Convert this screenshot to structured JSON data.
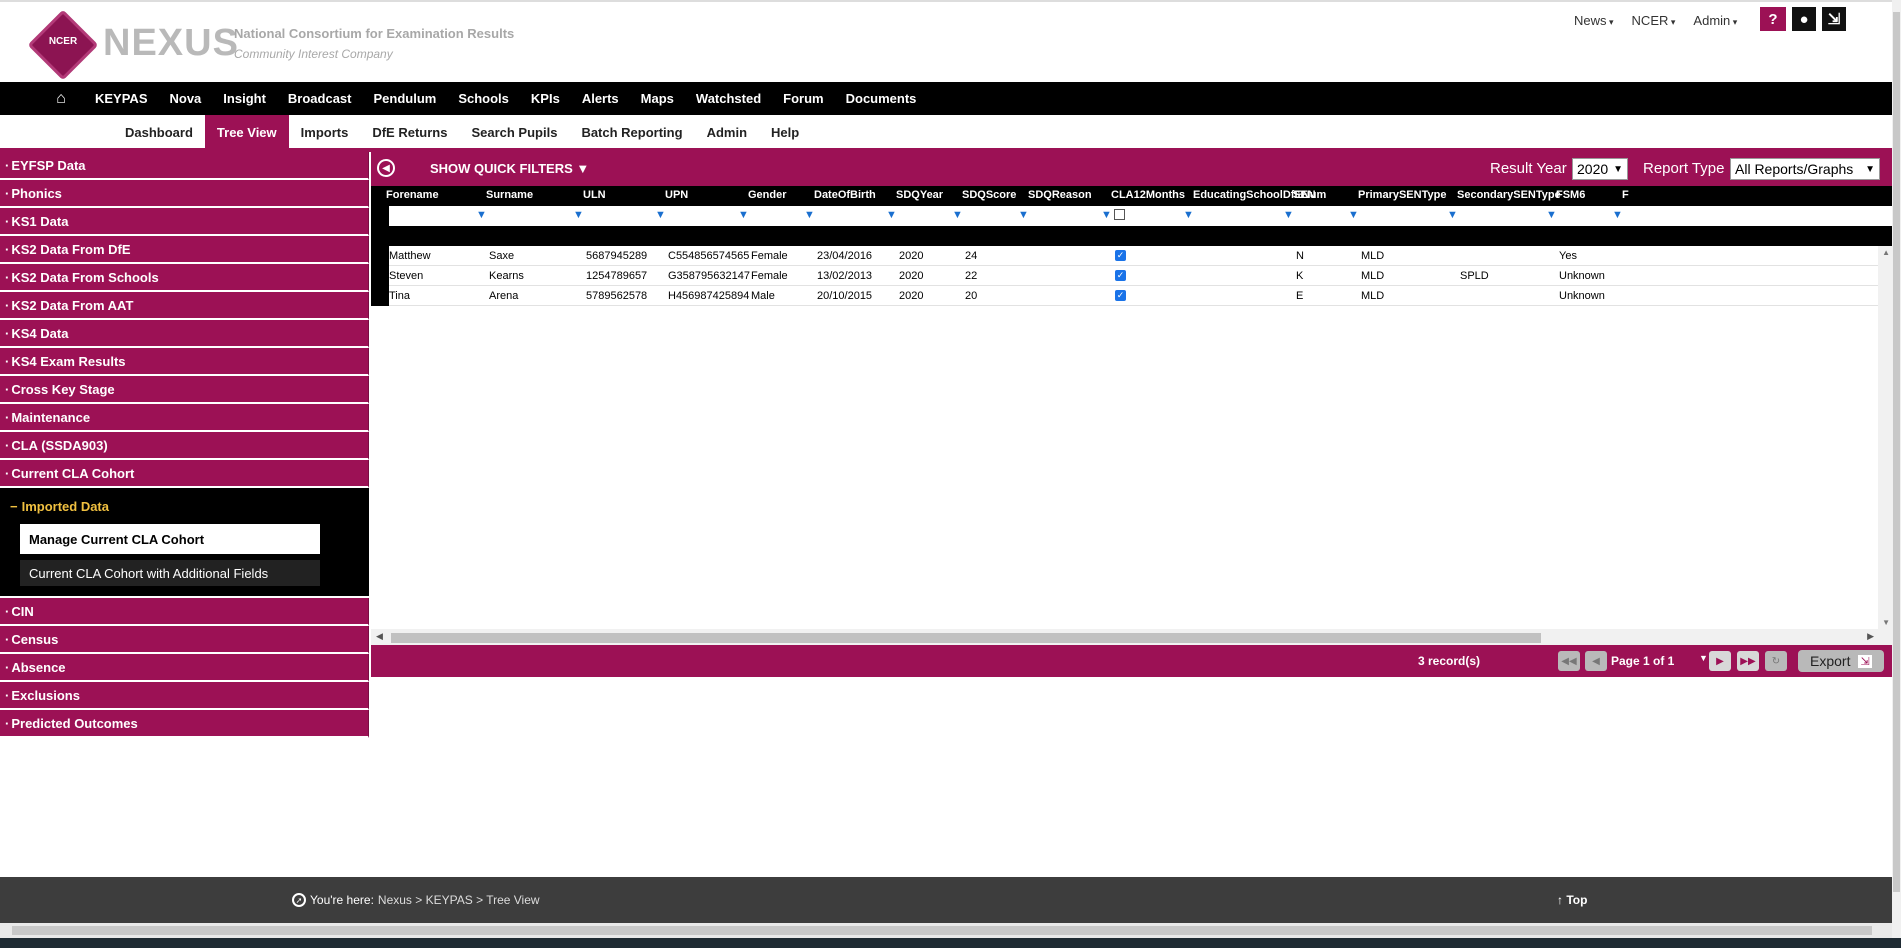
{
  "header": {
    "logo_badge": "NCER",
    "logo_word": "NEXUS",
    "subtitle_1": "National Consortium for Examination Results",
    "subtitle_2": "Community Interest Company",
    "links": [
      "News",
      "NCER",
      "Admin"
    ],
    "icons": [
      "help-icon",
      "user-icon",
      "logout-icon"
    ]
  },
  "nav_main": [
    "KEYPAS",
    "Nova",
    "Insight",
    "Broadcast",
    "Pendulum",
    "Schools",
    "KPIs",
    "Alerts",
    "Maps",
    "Watchsted",
    "Forum",
    "Documents"
  ],
  "nav_sub": [
    "Dashboard",
    "Tree View",
    "Imports",
    "DfE Returns",
    "Search Pupils",
    "Batch Reporting",
    "Admin",
    "Help"
  ],
  "nav_sub_active": "Tree View",
  "tree": {
    "items_before": [
      "EYFSP Data",
      "Phonics",
      "KS1 Data",
      "KS2 Data From DfE",
      "KS2 Data From Schools",
      "KS2 Data From AAT",
      "KS4 Data",
      "KS4 Exam Results",
      "Cross Key Stage",
      "Maintenance",
      "CLA (SSDA903)",
      "Current CLA Cohort"
    ],
    "open_sub": "Imported Data",
    "leaves": [
      "Manage Current CLA Cohort",
      "Current CLA Cohort with Additional Fields"
    ],
    "items_after": [
      "CIN",
      "Census",
      "Absence",
      "Exclusions",
      "Predicted Outcomes"
    ]
  },
  "toolbar": {
    "quick_filters": "SHOW QUICK FILTERS ▼",
    "result_year_label": "Result Year",
    "result_year_value": "2020",
    "report_type_label": "Report Type",
    "report_type_value": "All Reports/Graphs"
  },
  "grid": {
    "columns": [
      "Forename",
      "Surname",
      "ULN",
      "UPN",
      "Gender",
      "DateOfBirth",
      "SDQYear",
      "SDQScore",
      "SDQReason",
      "CLA12Months",
      "EducatingSchoolDfENum",
      "SEN",
      "PrimarySENType",
      "SecondarySENType",
      "FSM6",
      "F"
    ],
    "rows": [
      [
        "Matthew",
        "Saxe",
        "5687945289",
        "C554856574565",
        "Female",
        "23/04/2016",
        "2020",
        "24",
        "",
        "✓",
        "",
        "N",
        "MLD",
        "",
        "Yes"
      ],
      [
        "Steven",
        "Kearns",
        "1254789657",
        "G358795632147",
        "Female",
        "13/02/2013",
        "2020",
        "22",
        "",
        "✓",
        "",
        "K",
        "MLD",
        "SPLD",
        "Unknown"
      ],
      [
        "Tina",
        "Arena",
        "5789562578",
        "H456987425894",
        "Male",
        "20/10/2015",
        "2020",
        "20",
        "",
        "✓",
        "",
        "E",
        "MLD",
        "",
        "Unknown"
      ]
    ]
  },
  "pager": {
    "records": "3 record(s)",
    "page": "Page 1 of 1",
    "export": "Export"
  },
  "footer": {
    "you_are_here": "You're here:",
    "crumbs": "Nexus > KEYPAS > Tree View",
    "top": "↑ Top"
  }
}
